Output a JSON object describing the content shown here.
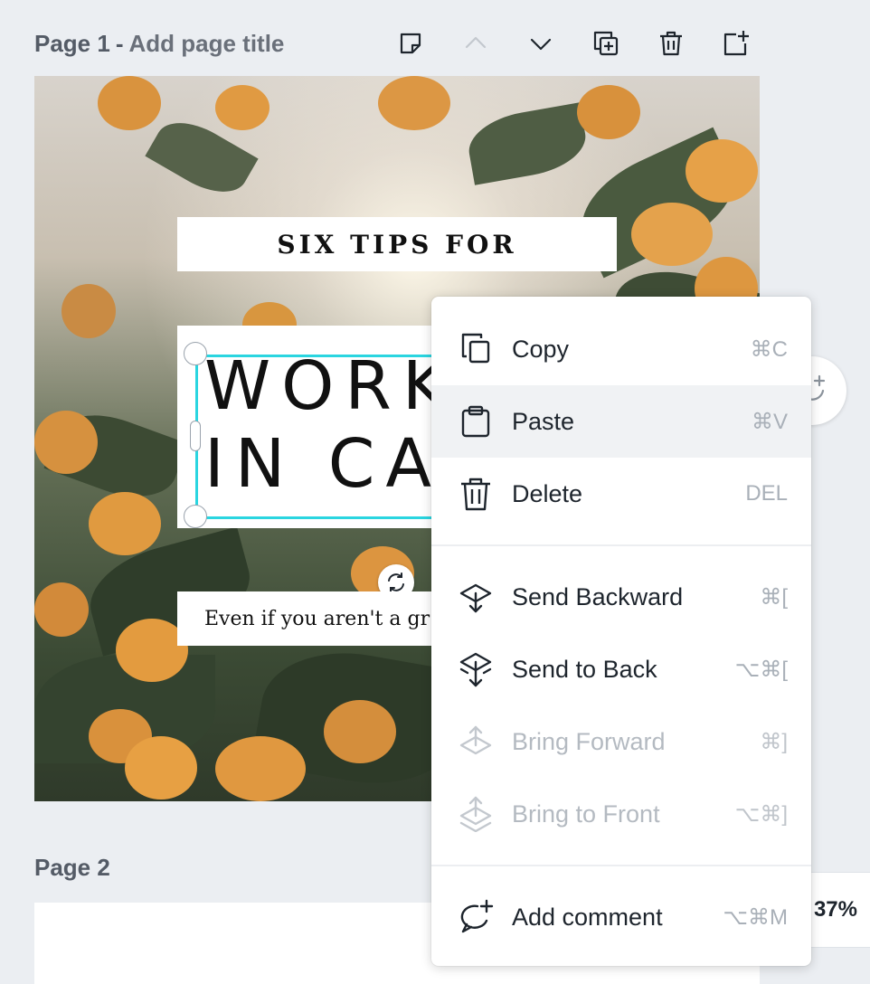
{
  "page1": {
    "label": "Page 1",
    "separator": "-",
    "title_placeholder": "Add page title"
  },
  "toolbar": {
    "icons": [
      "notes-icon",
      "chevron-up-icon",
      "chevron-down-icon",
      "duplicate-page-icon",
      "trash-icon",
      "add-page-icon"
    ]
  },
  "design": {
    "headline_small": "SIX TIPS FOR",
    "headline_big": "WORK\nIN CA",
    "subtext": "Even if you aren't a gr",
    "selection_color": "#2ad5e0"
  },
  "page2": {
    "label": "Page 2"
  },
  "zoom": {
    "value": "37%"
  },
  "context_menu": {
    "groups": [
      [
        {
          "label": "Copy",
          "shortcut": "⌘C",
          "icon": "copy-icon",
          "disabled": false
        },
        {
          "label": "Paste",
          "shortcut": "⌘V",
          "icon": "clipboard-icon",
          "disabled": false,
          "hovered": true
        },
        {
          "label": "Delete",
          "shortcut": "DEL",
          "icon": "trash-icon",
          "disabled": false
        }
      ],
      [
        {
          "label": "Send Backward",
          "shortcut": "⌘[",
          "icon": "send-backward-icon",
          "disabled": false
        },
        {
          "label": "Send to Back",
          "shortcut": "⌥⌘[",
          "icon": "send-to-back-icon",
          "disabled": false
        },
        {
          "label": "Bring Forward",
          "shortcut": "⌘]",
          "icon": "bring-forward-icon",
          "disabled": true
        },
        {
          "label": "Bring to Front",
          "shortcut": "⌥⌘]",
          "icon": "bring-to-front-icon",
          "disabled": true
        }
      ],
      [
        {
          "label": "Add comment",
          "shortcut": "⌥⌘M",
          "icon": "add-comment-icon",
          "disabled": false
        }
      ]
    ]
  }
}
